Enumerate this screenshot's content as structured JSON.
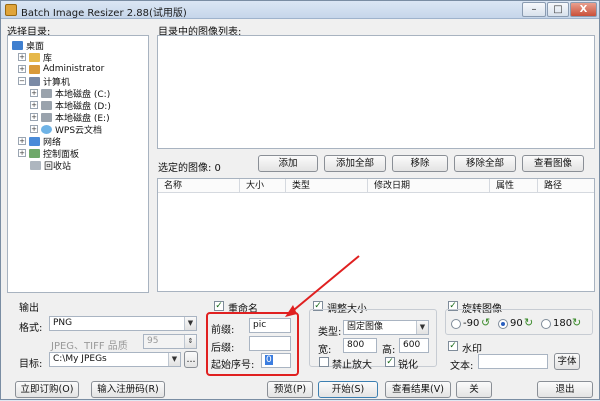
{
  "window": {
    "title": "Batch Image Resizer 2.88(试用版)",
    "minimize": "–",
    "maximize": "□",
    "close": "X"
  },
  "left": {
    "select_dir_label": "选择目录:",
    "tree": [
      "桌面",
      "库",
      "Administrator",
      "计算机",
      "本地磁盘 (C:)",
      "本地磁盘 (D:)",
      "本地磁盘 (E:)",
      "WPS云文档",
      "网络",
      "控制面板",
      "回收站"
    ]
  },
  "right": {
    "images_in_dir_label": "目录中的图像列表:",
    "selected_label": "选定的图像: 0",
    "buttons": {
      "add": "添加",
      "add_all": "添加全部",
      "remove": "移除",
      "remove_all": "移除全部",
      "view": "查看图像"
    },
    "columns": [
      "名称",
      "大小",
      "类型",
      "修改日期",
      "属性",
      "路径"
    ]
  },
  "output": {
    "section_label": "输出",
    "format_label": "格式:",
    "format_value": "PNG",
    "jpeg_tiff_quality_label": "JPEG、TIFF 品质",
    "quality_value": "95",
    "target_label": "目标:",
    "target_value": "C:\\My JPEGs",
    "browse": "..."
  },
  "rename": {
    "checkbox_label": "重命名",
    "prefix_label": "前缀:",
    "prefix_value": "pic",
    "suffix_label": "后缀:",
    "suffix_value": "",
    "start_label": "起始序号:",
    "start_value": "0"
  },
  "resize": {
    "checkbox_label": "调整大小",
    "type_label": "类型:",
    "type_value": "固定图像",
    "width_label": "宽:",
    "width_value": "800",
    "height_label": "高:",
    "height_value": "600",
    "no_enlarge_label": "禁止放大",
    "sharpen_label": "锐化"
  },
  "rotate": {
    "checkbox_label": "旋转图像",
    "options": [
      "-90",
      "90",
      "180"
    ],
    "selected": "90"
  },
  "watermark": {
    "checkbox_label": "水印",
    "text_label": "文本:",
    "font_button": "字体"
  },
  "bottom": {
    "buy_now": "立即订购(O)",
    "enter_code": "输入注册码(R)",
    "preview": "预览(P)",
    "start": "开始(S)",
    "view_results": "查看结果(V)",
    "about": "关",
    "exit": "退出"
  }
}
